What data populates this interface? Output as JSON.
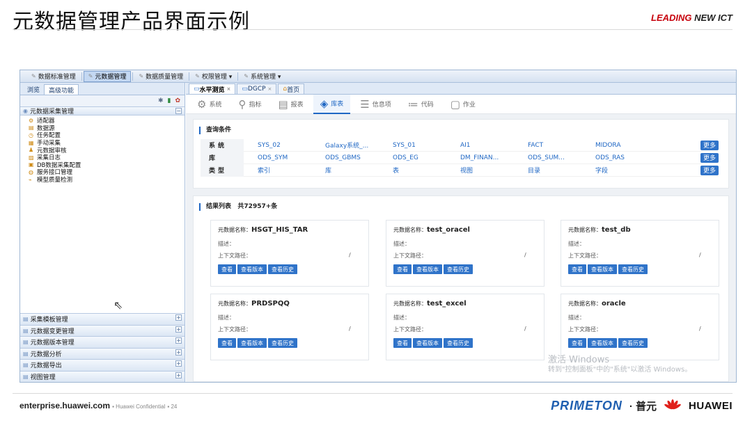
{
  "slide": {
    "title": "元数据管理产品界面示例",
    "brand_red": "LEADING",
    "brand_rest": " NEW ICT"
  },
  "menubar": [
    {
      "label": "数据标准管理"
    },
    {
      "label": "元数据管理",
      "active": true
    },
    {
      "label": "数据质量管理"
    },
    {
      "label": "权限管理 ▾"
    },
    {
      "label": "系统管理 ▾"
    }
  ],
  "left": {
    "tabs": [
      "浏览",
      "高级功能"
    ],
    "group_title": "元数据采集管理",
    "tree": [
      {
        "label": "适配器",
        "icon": "adapter-icon"
      },
      {
        "label": "数据源",
        "icon": "datasource-icon"
      },
      {
        "label": "任务配置",
        "icon": "task-icon"
      },
      {
        "label": "手动采集",
        "icon": "manual-icon"
      },
      {
        "label": "元数据审核",
        "icon": "audit-icon"
      },
      {
        "label": "采集日志",
        "icon": "log-icon"
      },
      {
        "label": "DB数据采集配置",
        "icon": "db-icon"
      },
      {
        "label": "服务接口管理",
        "icon": "service-icon"
      },
      {
        "label": "模型质量检测",
        "icon": "check-icon"
      }
    ],
    "bottom_groups": [
      "采集模板管理",
      "元数据变更管理",
      "元数据版本管理",
      "元数据分析",
      "元数据导出",
      "视图管理"
    ]
  },
  "right": {
    "tabs": [
      {
        "label": "水平测览",
        "active": true,
        "closable": true
      },
      {
        "label": "DGCP",
        "closable": true
      },
      {
        "label": "首页",
        "closable": false
      }
    ],
    "objbar": [
      {
        "label": "系统",
        "icon": "gear-icon"
      },
      {
        "label": "指标",
        "icon": "metric-icon"
      },
      {
        "label": "报表",
        "icon": "report-icon"
      },
      {
        "label": "库表",
        "icon": "layers-icon",
        "active": true
      },
      {
        "label": "信息项",
        "icon": "lines-icon"
      },
      {
        "label": "代码",
        "icon": "list-icon"
      },
      {
        "label": "作业",
        "icon": "job-icon"
      }
    ],
    "query": {
      "title": "查询条件",
      "more_label": "更多",
      "rows": [
        {
          "label": "系统",
          "values": [
            "SYS_02",
            "Galaxy系统_...",
            "SYS_01",
            "AI1",
            "FACT",
            "MIDORA"
          ]
        },
        {
          "label": "库",
          "values": [
            "ODS_SYM",
            "ODS_GBMS",
            "ODS_EG",
            "DM_FINAN...",
            "ODS_SUM...",
            "ODS_RAS"
          ]
        },
        {
          "label": "类型",
          "values": [
            "索引",
            "库",
            "表",
            "视图",
            "目录",
            "字段"
          ]
        }
      ]
    },
    "results": {
      "title": "结果列表",
      "count": "共72957+条",
      "name_label": "元数据名称：",
      "desc_label": "描述：",
      "path_label": "上下文路径：",
      "path_value": "/",
      "buttons": [
        "查看",
        "查看版本",
        "查看历史"
      ],
      "cards": [
        "HSGT_HIS_TAR",
        "test_oracel",
        "test_db",
        "PRDSPQQ",
        "test_excel",
        "oracle"
      ]
    },
    "watermark": {
      "line1": "激活 Windows",
      "line2": "转到\"控制面板\"中的\"系统\"以激活 Windows。"
    }
  },
  "footer": {
    "site": "enterprise.huawei.com",
    "conf": "Huawei Confidential",
    "page": "24",
    "primeton": "PRIMETON",
    "pu": "· 普元",
    "huawei": "HUAWEI"
  }
}
